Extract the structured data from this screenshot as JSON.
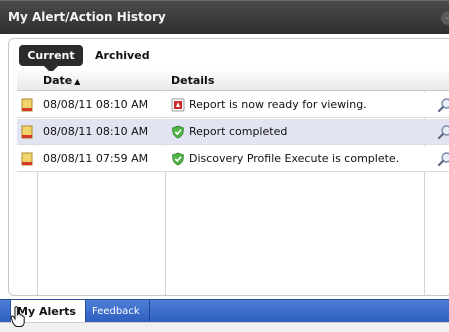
{
  "window": {
    "title": "My Alert/Action History"
  },
  "view_tabs": {
    "current_label": "Current",
    "archived_label": "Archived"
  },
  "grid": {
    "columns": {
      "date": "Date",
      "details": "Details"
    },
    "sort_indicator": "▲",
    "rows": [
      {
        "date": "08/08/11 08:10 AM",
        "details": "Report is now ready for viewing.",
        "details_icon": "pdf-report-icon",
        "flag_icon": "flag-icon",
        "action_icon": "magnifier-icon"
      },
      {
        "date": "08/08/11 08:10 AM",
        "details": "Report completed",
        "details_icon": "green-shield-check-icon",
        "flag_icon": "flag-icon",
        "action_icon": "magnifier-icon"
      },
      {
        "date": "08/08/11 07:59 AM",
        "details": "Discovery Profile Execute is complete.",
        "details_icon": "green-shield-check-icon",
        "flag_icon": "flag-icon",
        "action_icon": "magnifier-icon"
      }
    ]
  },
  "bottom_tabs": {
    "my_alerts": "My Alerts",
    "feedback": "Feedback"
  },
  "colors": {
    "title_bar": "#383838",
    "selected_row": "#e3e4f2",
    "bottom_bar": "#3b6cce"
  }
}
